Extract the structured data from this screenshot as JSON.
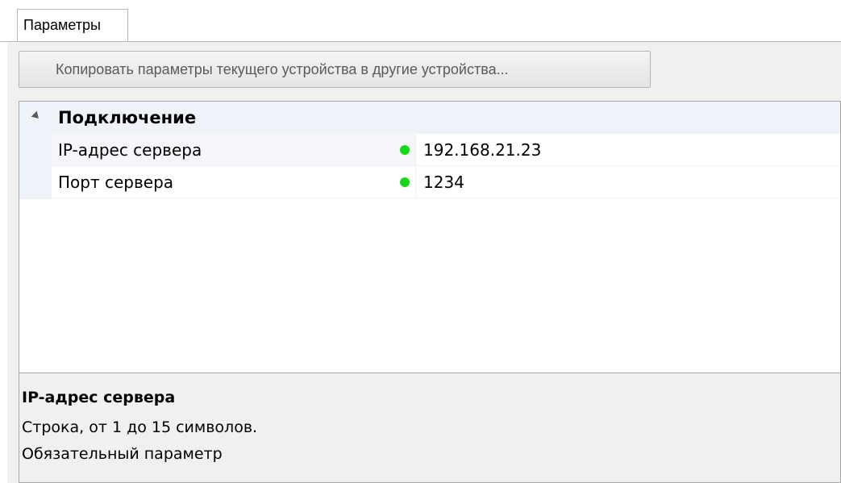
{
  "tabs": [
    {
      "label": "Параметры",
      "active": true
    }
  ],
  "toolbar": {
    "copy_button_label": "Копировать параметры текущего устройства в другие устройства..."
  },
  "property_grid": {
    "category": {
      "label": "Подключение",
      "expanded": true,
      "icon": "expanded-triangle-icon"
    },
    "properties": [
      {
        "name": "IP-адрес сервера",
        "value": "192.168.21.23",
        "status": "valid",
        "status_color": "#16d816",
        "selected": true
      },
      {
        "name": "Порт сервера",
        "value": "1234",
        "status": "valid",
        "status_color": "#16d816",
        "selected": false
      }
    ]
  },
  "description": {
    "title": "IP-адрес сервера",
    "line1": "Строка, от 1 до 15 символов.",
    "line2": "Обязательный параметр"
  },
  "colors": {
    "category_background": "#eef3f9",
    "panel_background": "#f0f0f0",
    "status_ok": "#16d816"
  }
}
